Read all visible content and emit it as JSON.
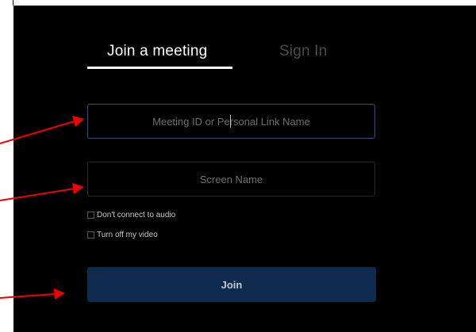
{
  "tabs": {
    "join_label": "Join a meeting",
    "signin_label": "Sign In"
  },
  "form": {
    "meeting_id_placeholder": "Meeting ID or Personal Link Name",
    "screen_name_placeholder": "Screen Name",
    "no_audio_label": "Don't connect to audio",
    "video_off_label": "Turn off my video",
    "join_label": "Join"
  },
  "colors": {
    "background": "#000000",
    "join_button": "#0e2a4c",
    "annotation_arrow": "#ee0000",
    "active_field_border": "#3a4f6e"
  }
}
